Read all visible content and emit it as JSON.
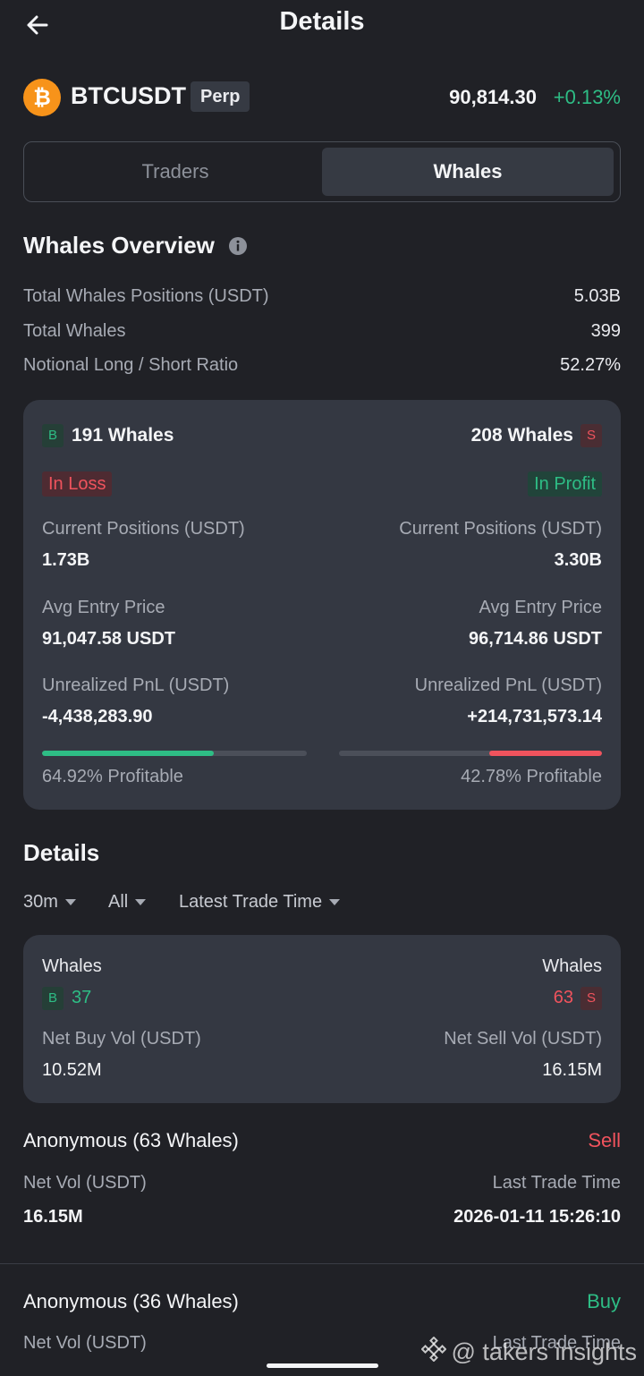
{
  "header": {
    "title": "Details"
  },
  "symbol": {
    "name": "BTCUSDT",
    "contract_type": "Perp",
    "price": "90,814.30",
    "change": "+0.13%",
    "coin_icon": "bitcoin-icon"
  },
  "tabs": [
    {
      "label": "Traders",
      "active": false
    },
    {
      "label": "Whales",
      "active": true
    }
  ],
  "overview": {
    "title": "Whales Overview",
    "rows": [
      {
        "label": "Total Whales Positions (USDT)",
        "value": "5.03B"
      },
      {
        "label": "Total Whales",
        "value": "399"
      },
      {
        "label": "Notional Long / Short Ratio",
        "value": "52.27%"
      }
    ]
  },
  "summary_card": {
    "long": {
      "badge": "B",
      "whales": "191 Whales",
      "status": "In Loss",
      "positions_label": "Current Positions (USDT)",
      "positions_value": "1.73B",
      "entry_label": "Avg Entry Price",
      "entry_value": "91,047.58 USDT",
      "pnl_label": "Unrealized PnL (USDT)",
      "pnl_value": "-4,438,283.90",
      "profitable_text": "64.92% Profitable",
      "profitable_fraction": 0.6492
    },
    "short": {
      "badge": "S",
      "whales": "208 Whales",
      "status": "In Profit",
      "positions_label": "Current Positions (USDT)",
      "positions_value": "3.30B",
      "entry_label": "Avg Entry Price",
      "entry_value": "96,714.86 USDT",
      "pnl_label": "Unrealized PnL (USDT)",
      "pnl_value": "+214,731,573.14",
      "profitable_text": "42.78% Profitable",
      "profitable_fraction": 0.4278
    }
  },
  "details": {
    "title": "Details",
    "filters": [
      "30m",
      "All",
      "Latest Trade Time"
    ],
    "net_card": {
      "buy_whales_label": "Whales",
      "buy_badge": "B",
      "buy_whales": "37",
      "sell_whales_label": "Whales",
      "sell_badge": "S",
      "sell_whales": "63",
      "buy_vol_label": "Net Buy Vol (USDT)",
      "buy_vol": "10.52M",
      "sell_vol_label": "Net Sell Vol (USDT)",
      "sell_vol": "16.15M"
    },
    "entries": [
      {
        "name": "Anonymous (63 Whales)",
        "side": "Sell",
        "net_vol_label": "Net Vol (USDT)",
        "net_vol": "16.15M",
        "time_label": "Last Trade Time",
        "time": "2026-01-11 15:26:10"
      },
      {
        "name": "Anonymous (36 Whales)",
        "side": "Buy",
        "net_vol_label": "Net Vol (USDT)",
        "time_label": "Last Trade Time"
      }
    ]
  },
  "watermark": {
    "text": "@ takers insights",
    "icon": "binance-icon"
  },
  "colors": {
    "background": "#202126",
    "card": "#343842",
    "green": "#2ebd85",
    "red": "#f0535d"
  }
}
